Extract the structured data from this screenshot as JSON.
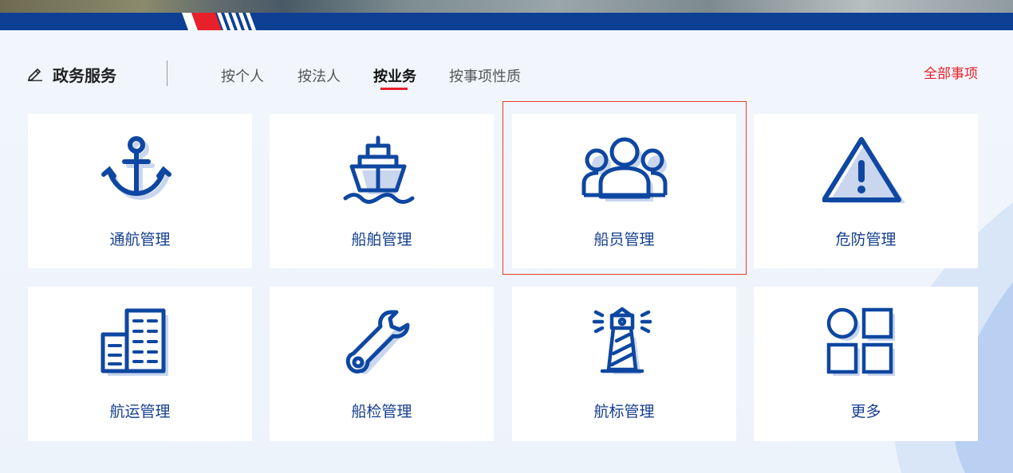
{
  "header": {
    "title": "政务服务",
    "all_items_label": "全部事项"
  },
  "tabs": [
    {
      "label": "按个人",
      "active": false
    },
    {
      "label": "按法人",
      "active": false
    },
    {
      "label": "按业务",
      "active": true
    },
    {
      "label": "按事项性质",
      "active": false
    }
  ],
  "cards": [
    {
      "label": "通航管理",
      "icon": "anchor-icon"
    },
    {
      "label": "船舶管理",
      "icon": "ship-icon"
    },
    {
      "label": "船员管理",
      "icon": "crew-icon",
      "highlighted": true
    },
    {
      "label": "危防管理",
      "icon": "warning-triangle-icon"
    },
    {
      "label": "航运管理",
      "icon": "building-icon"
    },
    {
      "label": "船检管理",
      "icon": "wrench-icon"
    },
    {
      "label": "航标管理",
      "icon": "lighthouse-icon"
    },
    {
      "label": "更多",
      "icon": "grid-more-icon"
    }
  ],
  "colors": {
    "brand_blue": "#0d3f94",
    "icon_blue": "#0e47a1",
    "icon_shadow": "#c9d6ee",
    "accent_red": "#e8202a",
    "label_blue": "#153f8f"
  }
}
